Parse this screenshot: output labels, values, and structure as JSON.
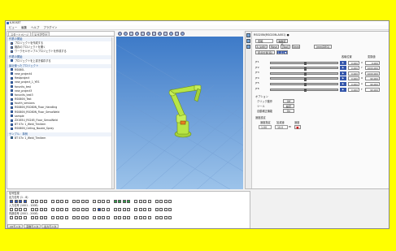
{
  "window": {
    "title": "K-ROSET"
  },
  "menu": [
    "ビュー",
    "編集",
    "ヘルプ",
    "プラグイン"
  ],
  "left_panel": {
    "tabs": [
      "スタートページ",
      "レイアウト"
    ],
    "sections": [
      {
        "title": "作業の開始",
        "items": [
          "プロジェクトを作成する",
          "既存のプロジェクトを開く",
          "ワークセルサンプルプロジェクトを作成する"
        ]
      },
      {
        "title": "作業の開始",
        "items": [
          "プロジェクトを上書き保存する"
        ]
      },
      {
        "title": "最近使ったプロジェクト",
        "items": [
          "RS080L",
          "new_project4",
          "ftestproject",
          "new_project_1_YES",
          "forunits_test",
          "new_project3",
          "fonunits_test3",
          "RS080N_Test",
          "fourth_versions",
          "RS080N_RS080N_Floor_Handling",
          "RS080N_RS080N_Floor_ServoWeld",
          "sample",
          "ZX165U_RS165_Floor_ServoWeld",
          "BT 07n 1_Weld_Timitem",
          "RS080N_Ceiling_Nozzle_Spray"
        ]
      },
      {
        "title": "サンプル：事例",
        "items": [
          "BT 07n 1_Weld_Timitem"
        ]
      }
    ]
  },
  "right_panel": {
    "title": "RS020N(RS020N-A001) ●",
    "mode_select": "各軸",
    "buttons": [
      "軸数変換",
      "1 (1) ▼"
    ],
    "config_buttons": [
      "A (orth)",
      "Move",
      "[Tool]",
      "5mm",
      "(mm/DEG)"
    ],
    "ref_label": "原点位置(追)",
    "headers": [
      "各軸位置",
      "変換値"
    ],
    "axes": [
      {
        "name": "JT1",
        "value": "0.000",
        "unit": "X",
        "value2": "0.000"
      },
      {
        "name": "JT2",
        "value": "0.000",
        "unit": "Y",
        "value2": "1000.000"
      },
      {
        "name": "JT3",
        "value": "0.000",
        "unit": "Z",
        "value2": "1000.000"
      },
      {
        "name": "JT4",
        "value": "0.000",
        "unit": "O",
        "value2": "90.000"
      },
      {
        "name": "JT5",
        "value": "0.000",
        "unit": "A",
        "value2": "90.000"
      },
      {
        "name": "JT6",
        "value": "0.000",
        "unit": "T",
        "value2": "90.000"
      }
    ],
    "options_label": "オプション",
    "options": [
      {
        "label": "クリック動作",
        "value": "Off"
      },
      {
        "label": "ツール",
        "value": "設定"
      },
      {
        "label": "自動補正機能",
        "value": "On"
      }
    ],
    "bottom_labels": [
      "速度設定",
      "速度指定",
      "加減速",
      "速度"
    ],
    "speed_value": "1.00",
    "accel_value": "10.0",
    "accel_unit": "m"
  },
  "bottom_panel": {
    "title": "信号監視",
    "groups": [
      {
        "label": "出力信号 (1 - 8)"
      },
      {
        "label": "入力信号 (1001 - 1008)"
      },
      {
        "label": "内部信号 (2001 - 2008)"
      }
    ],
    "tabs": [
      "I/Oモニタ",
      "変数モニタ",
      "出力モニタ"
    ]
  },
  "colors": {
    "accent": "#3355aa",
    "signal_on": "#2b58c8",
    "signal_green": "#2ea84a",
    "robot": "#b8e645",
    "background_outer": "#ffff00"
  }
}
